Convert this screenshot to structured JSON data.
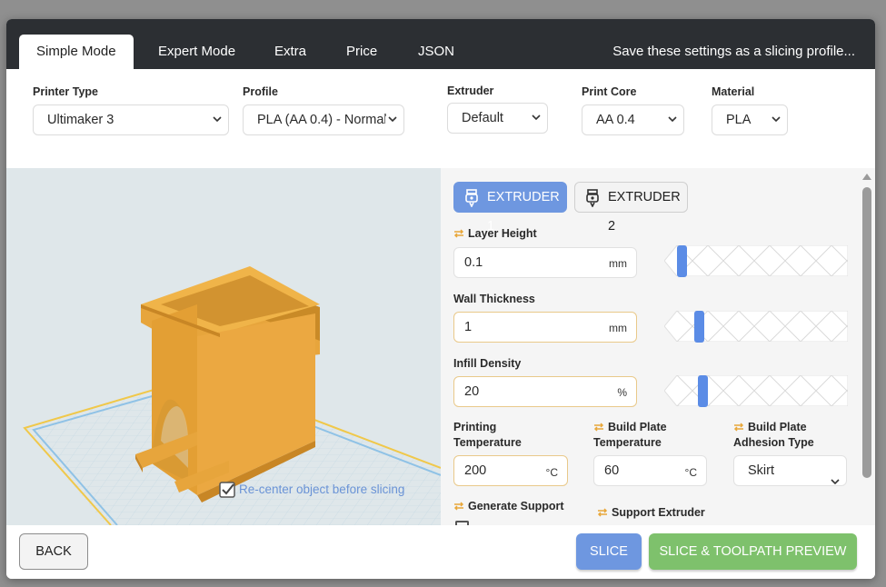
{
  "tabs": [
    {
      "label": "Simple Mode",
      "active": true
    },
    {
      "label": "Expert Mode",
      "active": false
    },
    {
      "label": "Extra",
      "active": false
    },
    {
      "label": "Price",
      "active": false
    },
    {
      "label": "JSON",
      "active": false
    }
  ],
  "save_profile_label": "Save these settings as a slicing profile...",
  "top_fields": {
    "printer_type": {
      "label": "Printer Type",
      "value": "Ultimaker 3"
    },
    "profile": {
      "label": "Profile",
      "value": "PLA (AA 0.4) - Normal"
    },
    "extruder": {
      "label": "Extruder",
      "value": "Default"
    },
    "print_core": {
      "label": "Print Core",
      "value": "AA 0.4"
    },
    "material": {
      "label": "Material",
      "value": "PLA"
    }
  },
  "viewport": {
    "recenter_label": "Re-center object before slicing",
    "recenter_checked": true,
    "model_color": "#e7a53c"
  },
  "extruders": [
    {
      "label": "EXTRUDER 1",
      "active": true
    },
    {
      "label": "EXTRUDER 2",
      "active": false
    }
  ],
  "settings": {
    "layer_height": {
      "label": "Layer Height",
      "value": "0.1",
      "unit": "mm",
      "linked": true,
      "slider_level": 0.05
    },
    "wall_thickness": {
      "label": "Wall Thickness",
      "value": "1",
      "unit": "mm",
      "linked": false,
      "slider_level": 0.15
    },
    "infill_density": {
      "label": "Infill Density",
      "value": "20",
      "unit": "%",
      "linked": false,
      "slider_level": 0.18
    },
    "printing_temperature": {
      "label_line1": "Printing",
      "label_line2": "Temperature",
      "value": "200",
      "unit": "°C",
      "linked": false
    },
    "build_plate_temperature": {
      "label_line1": "Build Plate",
      "label_line2": "Temperature",
      "value": "60",
      "unit": "°C",
      "linked": true
    },
    "build_plate_adhesion": {
      "label_line1": "Build Plate",
      "label_line2": "Adhesion Type",
      "value": "Skirt",
      "linked": true
    },
    "generate_support": {
      "label": "Generate Support",
      "linked": true
    },
    "support_extruder": {
      "label": "Support Extruder",
      "linked": true
    }
  },
  "footer": {
    "back_label": "BACK",
    "slice_label": "SLICE",
    "preview_label": "SLICE & TOOLPATH PREVIEW"
  },
  "colors": {
    "accent_blue": "#6e97e0",
    "accent_green": "#7ec16c",
    "link_icon": "#e8a73a",
    "tabbar": "#2c2f33"
  }
}
